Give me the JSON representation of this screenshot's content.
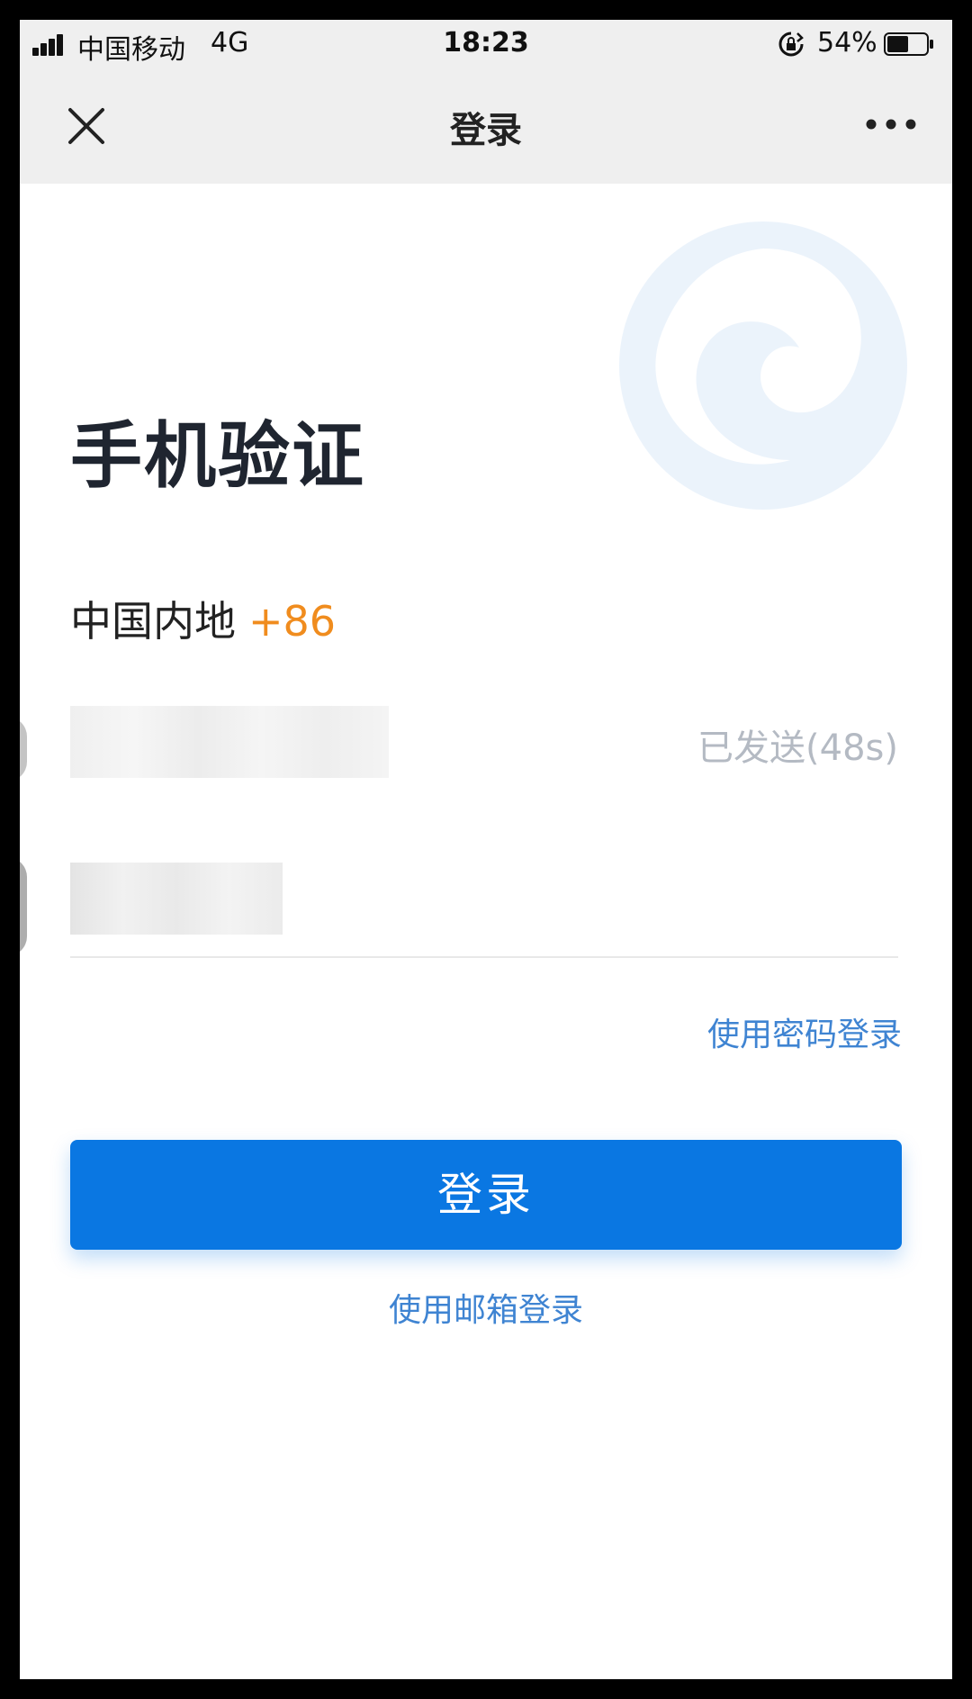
{
  "status_bar": {
    "carrier": "中国移动",
    "network": "4G",
    "time": "18:23",
    "battery_percent": "54%",
    "battery_level": 0.54
  },
  "nav": {
    "title": "登录"
  },
  "form": {
    "heading": "手机验证",
    "region_name": "中国内地",
    "region_code": "+86",
    "resend_label": "已发送(48s)",
    "password_login_label": "使用密码登录",
    "login_button_label": "登录",
    "email_login_label": "使用邮箱登录"
  },
  "colors": {
    "accent": "#0a77e2",
    "link": "#3f84d2",
    "region_code": "#f08c1e",
    "resend_disabled": "#b4bac3"
  }
}
